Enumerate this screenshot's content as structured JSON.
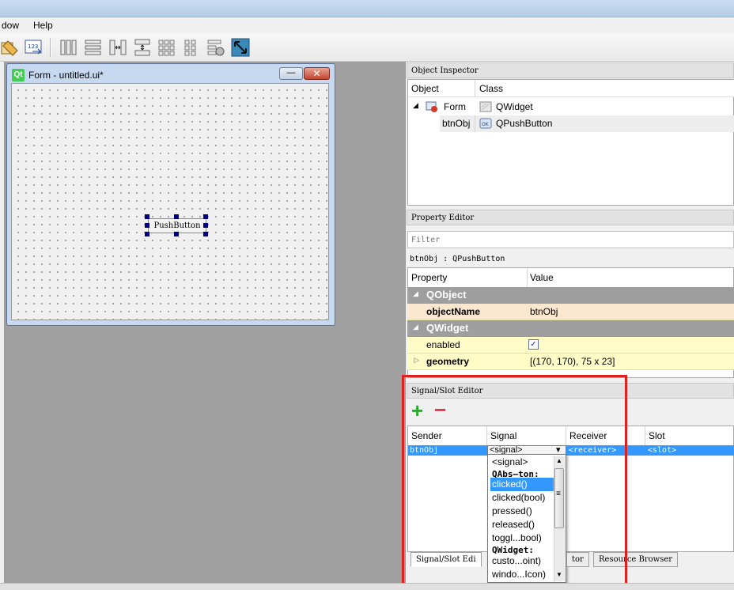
{
  "menu": {
    "items": [
      "dow",
      "Help"
    ]
  },
  "toolbar": {
    "icons": [
      "edit-tab-order-icon",
      "edit-buddies-icon",
      "layout-horizontal-icon",
      "layout-vertical-icon",
      "layout-splitter-horizontal-icon",
      "layout-splitter-vertical-icon",
      "layout-grid-icon",
      "layout-form-icon",
      "break-layout-icon",
      "adjust-size-icon"
    ]
  },
  "form": {
    "title": "Form - untitled.ui*",
    "logo": "Qt",
    "button_label": "PushButton",
    "min": "—",
    "close": "✕"
  },
  "object_inspector": {
    "title": "Object Inspector",
    "headers": [
      "Object",
      "Class"
    ],
    "rows": [
      {
        "object": "Form",
        "class": "QWidget",
        "expander": "◢"
      },
      {
        "object": "btnObj",
        "class": "QPushButton"
      }
    ]
  },
  "property_editor": {
    "title": "Property Editor",
    "filter_placeholder": "Filter",
    "context": "btnObj : QPushButton",
    "headers": [
      "Property",
      "Value"
    ],
    "groups": [
      {
        "name": "QObject",
        "expander": "◢"
      },
      {
        "name": "QWidget",
        "expander": "◢"
      }
    ],
    "rows": [
      {
        "name": "objectName",
        "value": "btnObj"
      },
      {
        "name": "enabled",
        "value": "✓"
      },
      {
        "name": "geometry",
        "value": "[(170, 170), 75 x 23]",
        "expander": "▷"
      }
    ]
  },
  "signal_slot_editor": {
    "title": "Signal/Slot Editor",
    "add": "+",
    "remove": "−",
    "headers": [
      "Sender",
      "Signal",
      "Receiver",
      "Slot"
    ],
    "row": {
      "sender": "btnObj",
      "signal": "<signal>",
      "receiver": "<receiver>",
      "slot": "<slot>",
      "arrow": "▾"
    },
    "dropdown_items": [
      "<signal>",
      "QAbs—ton:",
      "clicked()",
      "clicked(bool)",
      "pressed()",
      "released()",
      "toggl...bool)",
      "QWidget:",
      "custo...oint)",
      "windo...Icon)"
    ],
    "scroll_up": "▲",
    "scroll_down": "▼",
    "grip": "≡",
    "tabs": [
      "Signal/Slot Edi",
      "tor",
      "Resource Browser"
    ]
  },
  "colors": {
    "highlight": "#3399ff",
    "annotation": "#e02020",
    "group_band": "#9e9e9e",
    "property_row": "#fffcc8"
  }
}
